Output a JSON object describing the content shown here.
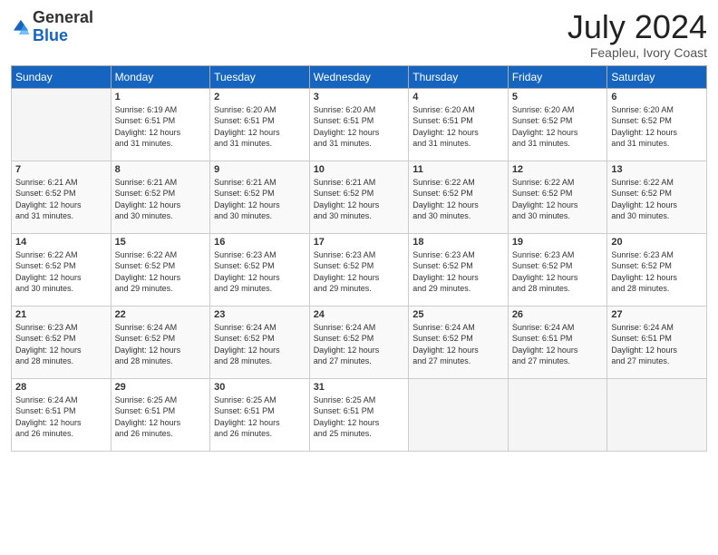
{
  "header": {
    "logo_general": "General",
    "logo_blue": "Blue",
    "month": "July 2024",
    "location": "Feapleu, Ivory Coast"
  },
  "columns": [
    "Sunday",
    "Monday",
    "Tuesday",
    "Wednesday",
    "Thursday",
    "Friday",
    "Saturday"
  ],
  "weeks": [
    [
      {
        "day": "",
        "info": ""
      },
      {
        "day": "1",
        "info": "Sunrise: 6:19 AM\nSunset: 6:51 PM\nDaylight: 12 hours\nand 31 minutes."
      },
      {
        "day": "2",
        "info": "Sunrise: 6:20 AM\nSunset: 6:51 PM\nDaylight: 12 hours\nand 31 minutes."
      },
      {
        "day": "3",
        "info": "Sunrise: 6:20 AM\nSunset: 6:51 PM\nDaylight: 12 hours\nand 31 minutes."
      },
      {
        "day": "4",
        "info": "Sunrise: 6:20 AM\nSunset: 6:51 PM\nDaylight: 12 hours\nand 31 minutes."
      },
      {
        "day": "5",
        "info": "Sunrise: 6:20 AM\nSunset: 6:52 PM\nDaylight: 12 hours\nand 31 minutes."
      },
      {
        "day": "6",
        "info": "Sunrise: 6:20 AM\nSunset: 6:52 PM\nDaylight: 12 hours\nand 31 minutes."
      }
    ],
    [
      {
        "day": "7",
        "info": "Sunrise: 6:21 AM\nSunset: 6:52 PM\nDaylight: 12 hours\nand 31 minutes."
      },
      {
        "day": "8",
        "info": "Sunrise: 6:21 AM\nSunset: 6:52 PM\nDaylight: 12 hours\nand 30 minutes."
      },
      {
        "day": "9",
        "info": "Sunrise: 6:21 AM\nSunset: 6:52 PM\nDaylight: 12 hours\nand 30 minutes."
      },
      {
        "day": "10",
        "info": "Sunrise: 6:21 AM\nSunset: 6:52 PM\nDaylight: 12 hours\nand 30 minutes."
      },
      {
        "day": "11",
        "info": "Sunrise: 6:22 AM\nSunset: 6:52 PM\nDaylight: 12 hours\nand 30 minutes."
      },
      {
        "day": "12",
        "info": "Sunrise: 6:22 AM\nSunset: 6:52 PM\nDaylight: 12 hours\nand 30 minutes."
      },
      {
        "day": "13",
        "info": "Sunrise: 6:22 AM\nSunset: 6:52 PM\nDaylight: 12 hours\nand 30 minutes."
      }
    ],
    [
      {
        "day": "14",
        "info": "Sunrise: 6:22 AM\nSunset: 6:52 PM\nDaylight: 12 hours\nand 30 minutes."
      },
      {
        "day": "15",
        "info": "Sunrise: 6:22 AM\nSunset: 6:52 PM\nDaylight: 12 hours\nand 29 minutes."
      },
      {
        "day": "16",
        "info": "Sunrise: 6:23 AM\nSunset: 6:52 PM\nDaylight: 12 hours\nand 29 minutes."
      },
      {
        "day": "17",
        "info": "Sunrise: 6:23 AM\nSunset: 6:52 PM\nDaylight: 12 hours\nand 29 minutes."
      },
      {
        "day": "18",
        "info": "Sunrise: 6:23 AM\nSunset: 6:52 PM\nDaylight: 12 hours\nand 29 minutes."
      },
      {
        "day": "19",
        "info": "Sunrise: 6:23 AM\nSunset: 6:52 PM\nDaylight: 12 hours\nand 28 minutes."
      },
      {
        "day": "20",
        "info": "Sunrise: 6:23 AM\nSunset: 6:52 PM\nDaylight: 12 hours\nand 28 minutes."
      }
    ],
    [
      {
        "day": "21",
        "info": "Sunrise: 6:23 AM\nSunset: 6:52 PM\nDaylight: 12 hours\nand 28 minutes."
      },
      {
        "day": "22",
        "info": "Sunrise: 6:24 AM\nSunset: 6:52 PM\nDaylight: 12 hours\nand 28 minutes."
      },
      {
        "day": "23",
        "info": "Sunrise: 6:24 AM\nSunset: 6:52 PM\nDaylight: 12 hours\nand 28 minutes."
      },
      {
        "day": "24",
        "info": "Sunrise: 6:24 AM\nSunset: 6:52 PM\nDaylight: 12 hours\nand 27 minutes."
      },
      {
        "day": "25",
        "info": "Sunrise: 6:24 AM\nSunset: 6:52 PM\nDaylight: 12 hours\nand 27 minutes."
      },
      {
        "day": "26",
        "info": "Sunrise: 6:24 AM\nSunset: 6:51 PM\nDaylight: 12 hours\nand 27 minutes."
      },
      {
        "day": "27",
        "info": "Sunrise: 6:24 AM\nSunset: 6:51 PM\nDaylight: 12 hours\nand 27 minutes."
      }
    ],
    [
      {
        "day": "28",
        "info": "Sunrise: 6:24 AM\nSunset: 6:51 PM\nDaylight: 12 hours\nand 26 minutes."
      },
      {
        "day": "29",
        "info": "Sunrise: 6:25 AM\nSunset: 6:51 PM\nDaylight: 12 hours\nand 26 minutes."
      },
      {
        "day": "30",
        "info": "Sunrise: 6:25 AM\nSunset: 6:51 PM\nDaylight: 12 hours\nand 26 minutes."
      },
      {
        "day": "31",
        "info": "Sunrise: 6:25 AM\nSunset: 6:51 PM\nDaylight: 12 hours\nand 25 minutes."
      },
      {
        "day": "",
        "info": ""
      },
      {
        "day": "",
        "info": ""
      },
      {
        "day": "",
        "info": ""
      }
    ]
  ]
}
